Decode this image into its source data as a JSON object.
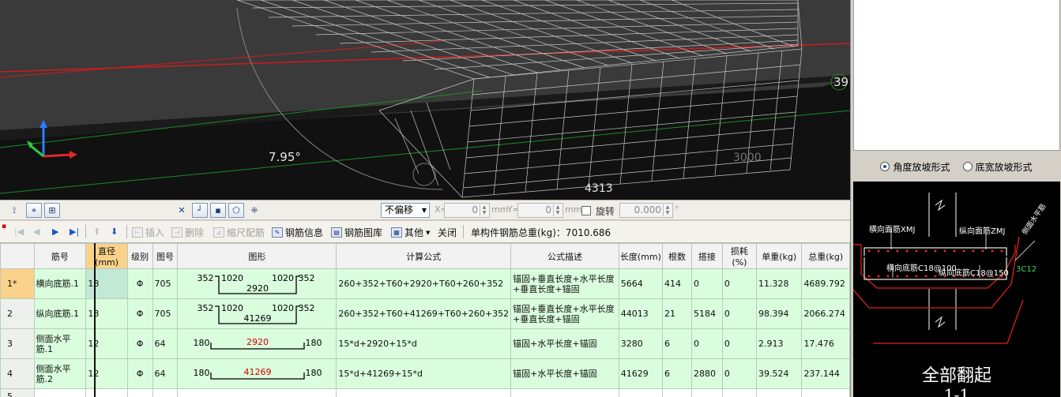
{
  "viewport": {
    "angle_label": "7.95°",
    "dim_label_bottom": "4313",
    "dim_label_right": "3000",
    "axis_label_right": "39"
  },
  "right_panel": {
    "slope_options": [
      {
        "label": "角度放坡形式",
        "checked": true
      },
      {
        "label": "底宽放坡形式",
        "checked": false
      }
    ],
    "cad": {
      "labels": {
        "top_bar_horizontal": "横向面筋",
        "top_bar_horizontal_suffix": "XMJ",
        "top_bar_vertical": "纵向面筋",
        "top_bar_vertical_suffix": "ZMJ",
        "bottom_bar_horizontal": "横向底筋",
        "bottom_bar_horizontal_spec": "C18@100",
        "bottom_bar_vertical": "纵向底筋",
        "bottom_bar_vertical_spec": "C18@150",
        "side_bar": "3C12",
        "side_label": "侧面水平筋"
      },
      "caption": "全部翻起",
      "caption_2": "1-1"
    }
  },
  "toolbar1": {
    "offset_select": "不偏移",
    "x_label": "X=",
    "x_value": "0",
    "x_unit": "mm",
    "y_label": "Y=",
    "y_value": "0",
    "y_unit": "mm",
    "rotate_label": "旋转",
    "rotate_value": "0.000",
    "rotate_unit": "°"
  },
  "toolbar2": {
    "insert": "插入",
    "delete": "删除",
    "scale_rebar": "缩尺配筋",
    "rebar_info": "钢筋信息",
    "rebar_library": "钢筋图库",
    "other": "其他",
    "close": "关闭",
    "total_weight": "单构件钢筋总重(kg)：7010.686"
  },
  "table": {
    "columns": [
      "筋号",
      "直径(mm)",
      "级别",
      "图号",
      "图形",
      "计算公式",
      "公式描述",
      "长度(mm)",
      "根数",
      "搭接",
      "损耗(%)",
      "单重(kg)",
      "总重(kg)"
    ],
    "rows": [
      {
        "num": "1*",
        "name": "横向底筋.1",
        "diameter": "18",
        "grade": "Φ",
        "fig_no": "705",
        "shape": {
          "type": "u",
          "left_up": "352",
          "left": "1020",
          "mid": "2920",
          "right": "1020",
          "right_up": "352",
          "mid_color": "#000000"
        },
        "formula": "260+352+T60+2920+T60+260+352",
        "desc": "锚固+垂直长度+水平长度+垂直长度+锚固",
        "length": "5664",
        "count": "414",
        "lap": "0",
        "loss": "0",
        "unit_weight": "11.328",
        "total_weight": "4689.792"
      },
      {
        "num": "2",
        "name": "纵向底筋.1",
        "diameter": "18",
        "grade": "Φ",
        "fig_no": "705",
        "shape": {
          "type": "u",
          "left_up": "352",
          "left": "1020",
          "mid": "41269",
          "right": "1020",
          "right_up": "352",
          "mid_color": "#000000"
        },
        "formula": "260+352+T60+41269+T60+260+352",
        "desc": "锚固+垂直长度+水平长度+垂直长度+锚固",
        "length": "44013",
        "count": "21",
        "lap": "5184",
        "loss": "0",
        "unit_weight": "98.394",
        "total_weight": "2066.274"
      },
      {
        "num": "3",
        "name": "侧面水平筋.1",
        "diameter": "12",
        "grade": "Φ",
        "fig_no": "64",
        "shape": {
          "type": "flat",
          "left": "180",
          "mid": "2920",
          "right": "180",
          "mid_color": "#d40000"
        },
        "formula": "15*d+2920+15*d",
        "desc": "锚固+水平长度+锚固",
        "length": "3280",
        "count": "6",
        "lap": "0",
        "loss": "0",
        "unit_weight": "2.913",
        "total_weight": "17.476"
      },
      {
        "num": "4",
        "name": "侧面水平筋.2",
        "diameter": "12",
        "grade": "Φ",
        "fig_no": "64",
        "shape": {
          "type": "flat",
          "left": "180",
          "mid": "41269",
          "right": "180",
          "mid_color": "#d40000"
        },
        "formula": "15*d+41269+15*d",
        "desc": "锚固+水平长度+锚固",
        "length": "41629",
        "count": "6",
        "lap": "2880",
        "loss": "0",
        "unit_weight": "39.524",
        "total_weight": "237.144"
      }
    ],
    "empty_row_num": "5"
  }
}
